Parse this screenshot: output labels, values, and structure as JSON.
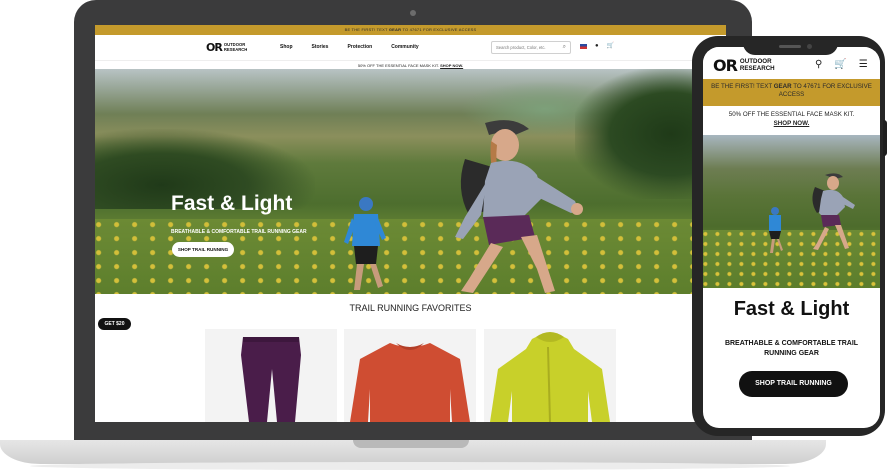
{
  "brand": {
    "mark": "OR",
    "name_line1": "OUTDOOR",
    "name_line2": "RESEARCH"
  },
  "desktop": {
    "promo_prefix": "BE THE FIRST! TEXT ",
    "promo_keyword": "GEAR",
    "promo_suffix": " TO 47671 FOR EXCLUSIVE ACCESS",
    "nav": [
      "Shop",
      "Stories",
      "Protection",
      "Community"
    ],
    "search_placeholder": "Search product, Color, etc.",
    "sub_promo_text": "50% OFF THE ESSENTIAL FACE MASK KIT. ",
    "sub_promo_link": "SHOP NOW.",
    "hero_title": "Fast & Light",
    "hero_subtitle": "BREATHABLE & COMFORTABLE TRAIL RUNNING GEAR",
    "hero_button": "SHOP TRAIL RUNNING",
    "section_title": "TRAIL RUNNING FAVORITES",
    "badge": "GET $20",
    "icons": [
      "flag-icon",
      "user-icon",
      "cart-icon"
    ]
  },
  "mobile": {
    "promo_prefix": "BE THE FIRST! TEXT ",
    "promo_keyword": "GEAR",
    "promo_suffix": " TO 47671 FOR EXCLUSIVE ACCESS",
    "sub_promo_text": "50% OFF THE ESSENTIAL FACE MASK KIT.",
    "sub_promo_link": "SHOP NOW.",
    "hero_title": "Fast & Light",
    "hero_subtitle": "BREATHABLE & COMFORTABLE TRAIL RUNNING GEAR",
    "hero_button": "SHOP TRAIL RUNNING",
    "icons": [
      "search-icon",
      "cart-icon",
      "menu-icon"
    ]
  },
  "colors": {
    "promo_gold": "#c49a2c",
    "device_dark": "#3b3b3c",
    "button_dark": "#111111",
    "legging": "#4a1d4a",
    "sweater": "#cf4d32",
    "jacket": "#c8d02a"
  }
}
